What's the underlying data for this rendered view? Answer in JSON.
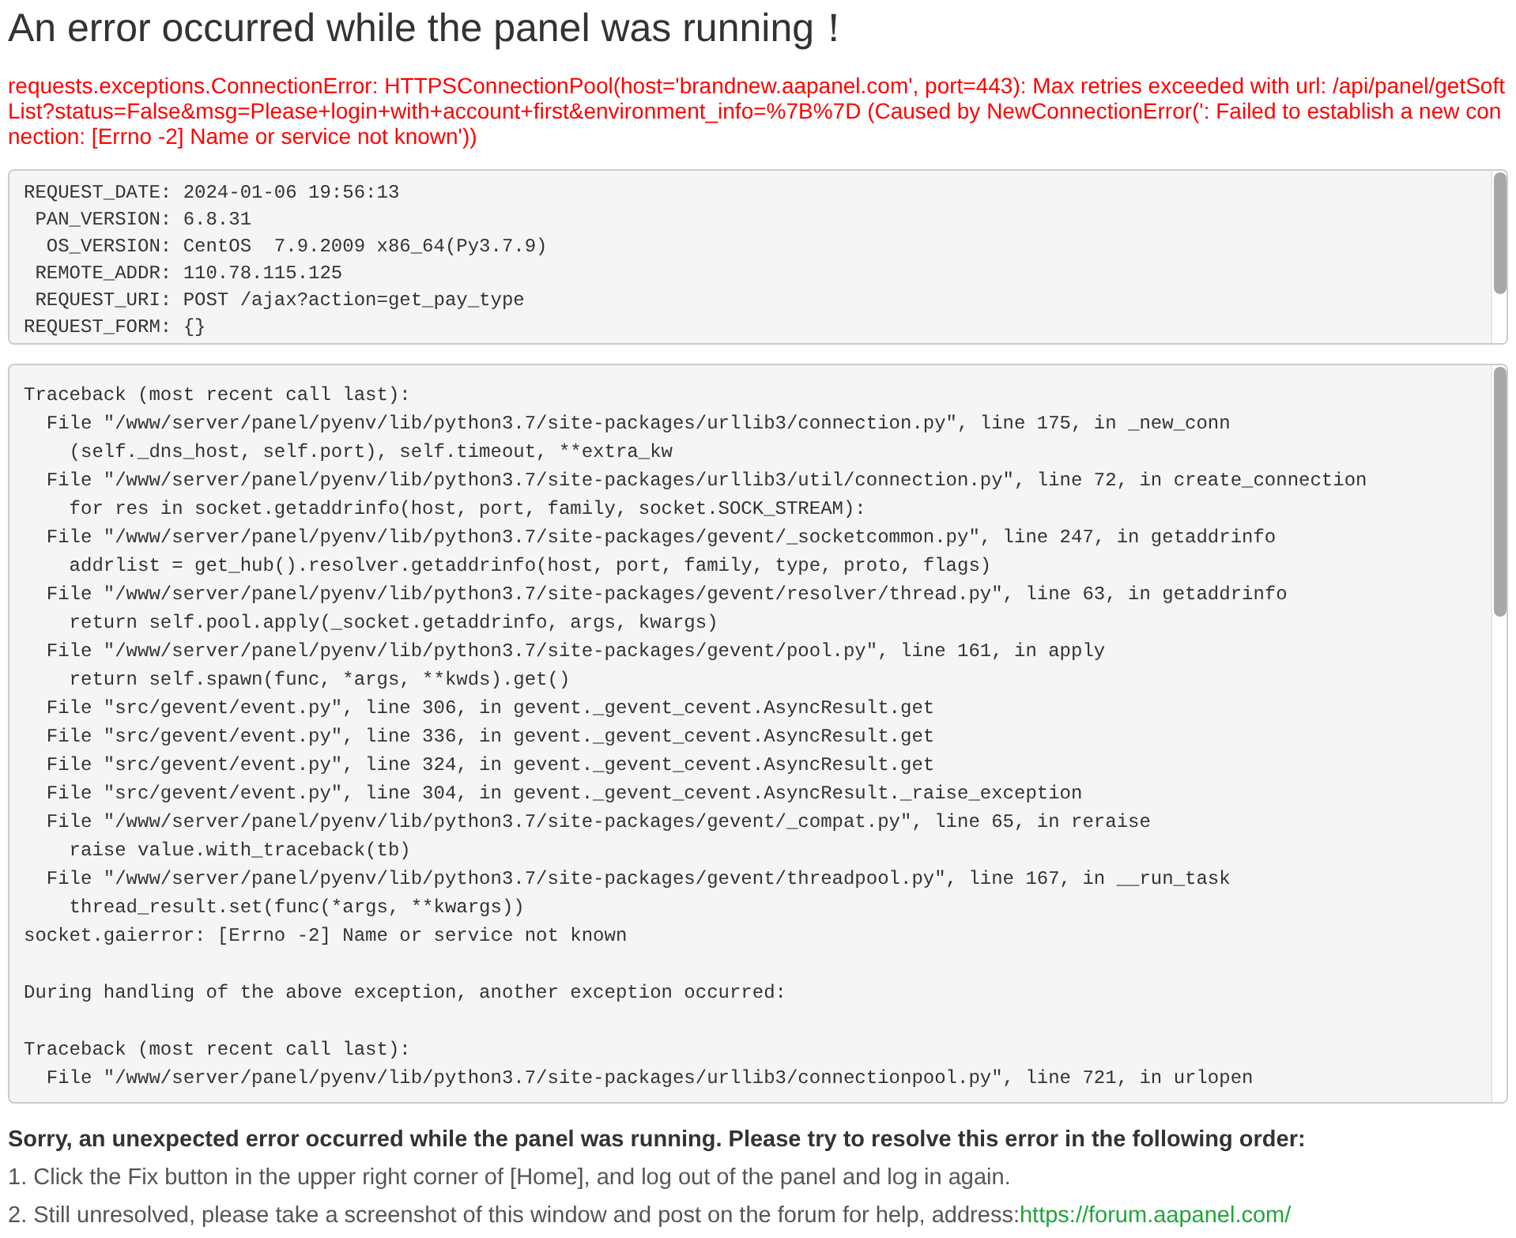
{
  "title": "An error occurred while the panel was running！",
  "error_message": "requests.exceptions.ConnectionError: HTTPSConnectionPool(host='brandnew.aapanel.com', port=443): Max retries exceeded with url: /api/panel/getSoftList?status=False&msg=Please+login+with+account+first&environment_info=%7B%7D (Caused by NewConnectionError(': Failed to establish a new connection: [Errno -2] Name or service not known'))",
  "request_info": {
    "lines": [
      "REQUEST_DATE: 2024-01-06 19:56:13",
      " PAN_VERSION: 6.8.31",
      "  OS_VERSION: CentOS  7.9.2009 x86_64(Py3.7.9)",
      " REMOTE_ADDR: 110.78.115.125",
      " REQUEST_URI: POST /ajax?action=get_pay_type",
      "REQUEST_FORM: {}"
    ]
  },
  "traceback": {
    "blocks": [
      [
        "Traceback (most recent call last):",
        "  File \"/www/server/panel/pyenv/lib/python3.7/site-packages/urllib3/connection.py\", line 175, in _new_conn",
        "    (self._dns_host, self.port), self.timeout, **extra_kw",
        "  File \"/www/server/panel/pyenv/lib/python3.7/site-packages/urllib3/util/connection.py\", line 72, in create_connection",
        "    for res in socket.getaddrinfo(host, port, family, socket.SOCK_STREAM):",
        "  File \"/www/server/panel/pyenv/lib/python3.7/site-packages/gevent/_socketcommon.py\", line 247, in getaddrinfo",
        "    addrlist = get_hub().resolver.getaddrinfo(host, port, family, type, proto, flags)",
        "  File \"/www/server/panel/pyenv/lib/python3.7/site-packages/gevent/resolver/thread.py\", line 63, in getaddrinfo",
        "    return self.pool.apply(_socket.getaddrinfo, args, kwargs)",
        "  File \"/www/server/panel/pyenv/lib/python3.7/site-packages/gevent/pool.py\", line 161, in apply",
        "    return self.spawn(func, *args, **kwds).get()",
        "  File \"src/gevent/event.py\", line 306, in gevent._gevent_cevent.AsyncResult.get",
        "  File \"src/gevent/event.py\", line 336, in gevent._gevent_cevent.AsyncResult.get",
        "  File \"src/gevent/event.py\", line 324, in gevent._gevent_cevent.AsyncResult.get",
        "  File \"src/gevent/event.py\", line 304, in gevent._gevent_cevent.AsyncResult._raise_exception",
        "  File \"/www/server/panel/pyenv/lib/python3.7/site-packages/gevent/_compat.py\", line 65, in reraise",
        "    raise value.with_traceback(tb)",
        "  File \"/www/server/panel/pyenv/lib/python3.7/site-packages/gevent/threadpool.py\", line 167, in __run_task",
        "    thread_result.set(func(*args, **kwargs))",
        "socket.gaierror: [Errno -2] Name or service not known"
      ],
      [
        "During handling of the above exception, another exception occurred:"
      ],
      [
        "Traceback (most recent call last):",
        "  File \"/www/server/panel/pyenv/lib/python3.7/site-packages/urllib3/connectionpool.py\", line 721, in urlopen"
      ]
    ]
  },
  "help": {
    "heading": "Sorry, an unexpected error occurred while the panel was running. Please try to resolve this error in the following order:",
    "steps": [
      {
        "text": "1. Click the Fix button in the upper right corner of [Home], and log out of the panel and log in again."
      },
      {
        "text": "2. Still unresolved, please take a screenshot of this window and post on the forum for help, address:",
        "link": "https://forum.aapanel.com/"
      }
    ]
  }
}
